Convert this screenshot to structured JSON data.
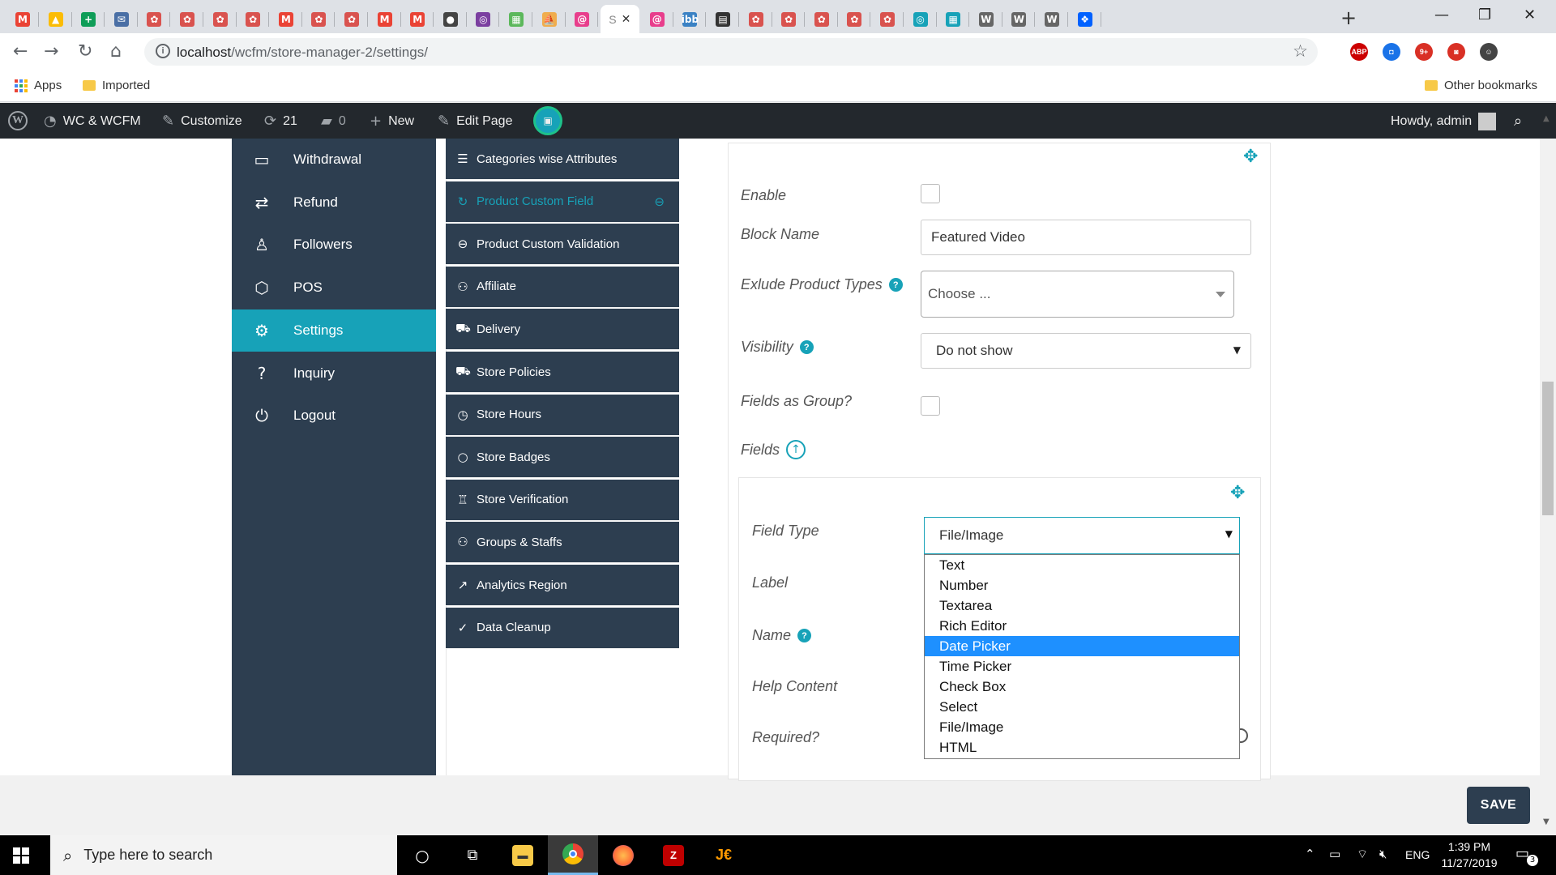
{
  "browser": {
    "tabs": [
      {
        "icon": "gmail-icon",
        "letter": "M",
        "color": "#ea4335"
      },
      {
        "icon": "drive-icon",
        "letter": "▲",
        "color": "#fbbc05"
      },
      {
        "icon": "sheets-icon",
        "letter": "+",
        "color": "#0f9d58"
      },
      {
        "icon": "mail-icon",
        "letter": "✉",
        "color": "#4a6fa5"
      },
      {
        "icon": "site-icon",
        "letter": "✿",
        "color": "#d9534f"
      },
      {
        "icon": "site-icon",
        "letter": "✿",
        "color": "#d9534f"
      },
      {
        "icon": "site-icon",
        "letter": "✿",
        "color": "#d9534f"
      },
      {
        "icon": "site-icon",
        "letter": "✿",
        "color": "#d9534f"
      },
      {
        "icon": "gmail-icon",
        "letter": "M",
        "color": "#ea4335"
      },
      {
        "icon": "site-icon",
        "letter": "✿",
        "color": "#d9534f"
      },
      {
        "icon": "site-icon",
        "letter": "✿",
        "color": "#d9534f"
      },
      {
        "icon": "gmail-icon",
        "letter": "M",
        "color": "#ea4335"
      },
      {
        "icon": "gmail-icon",
        "letter": "M",
        "color": "#ea4335"
      },
      {
        "icon": "hat-icon",
        "letter": "●",
        "color": "#444"
      },
      {
        "icon": "globe-icon",
        "letter": "◎",
        "color": "#7b3fa0"
      },
      {
        "icon": "cpanel-icon",
        "letter": "▦",
        "color": "#5cb85c"
      },
      {
        "icon": "pma-icon",
        "letter": "⛵",
        "color": "#f0ad4e"
      },
      {
        "icon": "app-icon",
        "letter": "@",
        "color": "#e83e8c"
      }
    ],
    "active_tab_letter": "S",
    "active_tab_close": "✕",
    "tabs_after": [
      {
        "icon": "app-icon",
        "letter": "@",
        "color": "#e83e8c"
      },
      {
        "icon": "ibb-icon",
        "letter": "ibb",
        "color": "#3b82c4"
      },
      {
        "icon": "film-icon",
        "letter": "▤",
        "color": "#333"
      },
      {
        "icon": "site-icon",
        "letter": "✿",
        "color": "#d9534f"
      },
      {
        "icon": "site-icon",
        "letter": "✿",
        "color": "#d9534f"
      },
      {
        "icon": "site-icon",
        "letter": "✿",
        "color": "#d9534f"
      },
      {
        "icon": "site-icon",
        "letter": "✿",
        "color": "#d9534f"
      },
      {
        "icon": "site-icon",
        "letter": "✿",
        "color": "#d9534f"
      },
      {
        "icon": "globe-icon",
        "letter": "◎",
        "color": "#17a2b8"
      },
      {
        "icon": "grid-icon",
        "letter": "▦",
        "color": "#17a2b8"
      },
      {
        "icon": "wordpress-icon",
        "letter": "W",
        "color": "#666"
      },
      {
        "icon": "wordpress-icon",
        "letter": "W",
        "color": "#666"
      },
      {
        "icon": "wordpress-icon",
        "letter": "W",
        "color": "#666"
      },
      {
        "icon": "dropbox-icon",
        "letter": "❖",
        "color": "#0061ff"
      }
    ],
    "new_tab": "+",
    "window_min": "—",
    "window_max": "❐",
    "window_close": "✕",
    "url_host": "localhost",
    "url_path": "/wcfm/store-manager-2/settings/",
    "bookmarks": {
      "apps": "Apps",
      "imported": "Imported",
      "other": "Other bookmarks"
    },
    "extensions": [
      {
        "icon": "abp-icon",
        "label": "ABP",
        "color": "#c00"
      },
      {
        "icon": "camera-icon",
        "label": "◘",
        "color": "#1a73e8"
      },
      {
        "icon": "badge-icon",
        "label": "9+",
        "color": "#d93025"
      },
      {
        "icon": "pocket-icon",
        "label": "◙",
        "color": "#d93025"
      },
      {
        "icon": "profile-icon",
        "label": "☺",
        "color": "#444"
      }
    ]
  },
  "adminbar": {
    "site": "WC & WCFM",
    "customize": "Customize",
    "updates": "21",
    "comments": "0",
    "new": "New",
    "edit_page": "Edit Page",
    "howdy": "Howdy, admin"
  },
  "sidebar": {
    "items": [
      {
        "label": "Withdrawal",
        "icon": "withdrawal-icon",
        "glyph": "▭"
      },
      {
        "label": "Refund",
        "icon": "refund-icon",
        "glyph": "⇄"
      },
      {
        "label": "Followers",
        "icon": "followers-icon",
        "glyph": "♙"
      },
      {
        "label": "POS",
        "icon": "pos-icon",
        "glyph": "⬡"
      },
      {
        "label": "Settings",
        "icon": "settings-icon",
        "glyph": "⚙"
      },
      {
        "label": "Inquiry",
        "icon": "inquiry-icon",
        "glyph": "?"
      },
      {
        "label": "Logout",
        "icon": "logout-icon",
        "glyph": "⏻"
      }
    ]
  },
  "submenu": {
    "items": [
      {
        "label": "Categories wise Attributes",
        "glyph": "☰"
      },
      {
        "label": "Product Custom Field",
        "glyph": "↻"
      },
      {
        "label": "Product Custom Validation",
        "glyph": "⊖"
      },
      {
        "label": "Affiliate",
        "glyph": "⚇"
      },
      {
        "label": "Delivery",
        "glyph": "⛟"
      },
      {
        "label": "Store Policies",
        "glyph": "⛟"
      },
      {
        "label": "Store Hours",
        "glyph": "◷"
      },
      {
        "label": "Store Badges",
        "glyph": "○"
      },
      {
        "label": "Store Verification",
        "glyph": "♖"
      },
      {
        "label": "Groups & Staffs",
        "glyph": "⚇"
      },
      {
        "label": "Analytics Region",
        "glyph": "↗"
      },
      {
        "label": "Data Cleanup",
        "glyph": "✓"
      }
    ],
    "current_end_glyph": "⊖"
  },
  "form": {
    "enable_label": "Enable",
    "block_name_label": "Block Name",
    "block_name_value": "Featured Video",
    "exclude_label": "Exlude Product Types",
    "exclude_placeholder": "Choose ...",
    "visibility_label": "Visibility",
    "visibility_value": "Do not show",
    "fields_group_label": "Fields as Group?",
    "fields_label": "Fields",
    "field_type_label": "Field Type",
    "field_type_value": "File/Image",
    "label_label": "Label",
    "name_label": "Name",
    "help_label": "Help Content",
    "required_label": "Required?",
    "tip_glyph": "?",
    "up_glyph": "↑",
    "move_glyph": "✥",
    "caret_glyph": "▼"
  },
  "dropdown": {
    "options": [
      "Text",
      "Number",
      "Textarea",
      "Rich Editor",
      "Date Picker",
      "Time Picker",
      "Check Box",
      "Select",
      "File/Image",
      "HTML"
    ],
    "highlighted": "Date Picker"
  },
  "save_label": "SAVE",
  "taskbar": {
    "search_placeholder": "Type here to search",
    "time": "1:39 PM",
    "date": "11/27/2019",
    "lang": "ENG",
    "notifications": "3"
  }
}
